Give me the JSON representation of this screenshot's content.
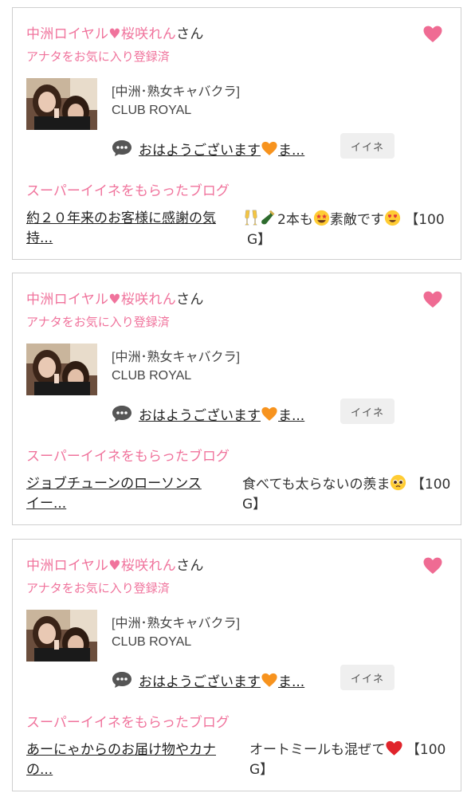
{
  "cards": [
    {
      "name": "中洲ロイヤル♥桜咲れん",
      "san": "さん",
      "favorite_status": "アナタをお気に入り登録済",
      "shop_genre": "[中洲･熟女キャバクラ]",
      "shop_name": "CLUB ROYAL",
      "blog_pre": "おはようございます",
      "blog_post": "ま...",
      "iine_label": "イイネ",
      "super_title": "スーパーイイネをもらったブログ",
      "super_line1": "約２０年来のお客様に感謝の気",
      "super_line2": "持...",
      "desc_a": "",
      "desc_b": "2本も",
      "desc_c": "素敵です",
      "desc_d": "【100",
      "desc_e": "G】"
    },
    {
      "name": "中洲ロイヤル♥桜咲れん",
      "san": "さん",
      "favorite_status": "アナタをお気に入り登録済",
      "shop_genre": "[中洲･熟女キャバクラ]",
      "shop_name": "CLUB ROYAL",
      "blog_pre": "おはようございます",
      "blog_post": "ま...",
      "iine_label": "イイネ",
      "super_title": "スーパーイイネをもらったブログ",
      "super_line1": "ジョブチューンのローソンス",
      "super_line2": "イー...",
      "desc_a": "食べても太らないの羨ま",
      "desc_d": "【100",
      "desc_e": "G】"
    },
    {
      "name": "中洲ロイヤル♥桜咲れん",
      "san": "さん",
      "favorite_status": "アナタをお気に入り登録済",
      "shop_genre": "[中洲･熟女キャバクラ]",
      "shop_name": "CLUB ROYAL",
      "blog_pre": "おはようございます",
      "blog_post": "ま...",
      "iine_label": "イイネ",
      "super_title": "スーパーイイネをもらったブログ",
      "super_line1": "あーにゃからのお届け物やカナ",
      "super_line2": "の...",
      "desc_a": "オートミールも混ぜて",
      "desc_d": "【100",
      "desc_e": "G】"
    }
  ],
  "colors": {
    "accent_pink": "#f0739c",
    "heart_pink": "#ef6b93",
    "orange_heart": "#f7931e",
    "border": "#cfcfcf",
    "iine_bg": "#efefef"
  },
  "icons": {
    "favorite": "heart-icon",
    "comment": "speech-bubble-icon",
    "blog_heart": "orange-heart-emoji"
  }
}
